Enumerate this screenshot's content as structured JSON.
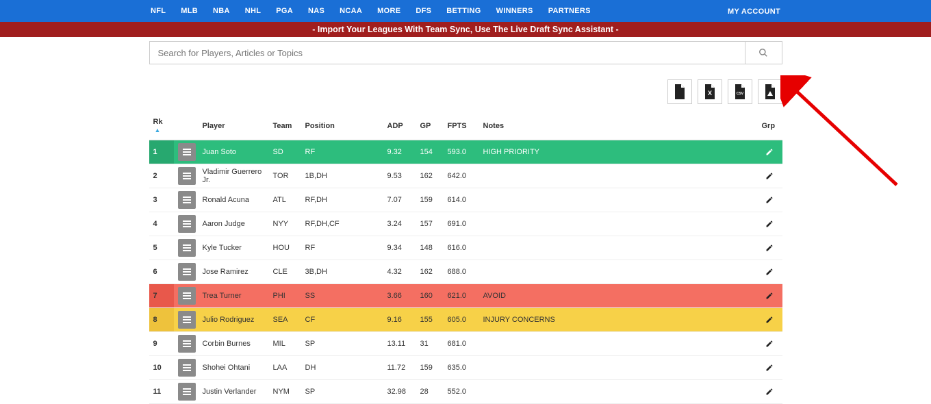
{
  "nav": {
    "items": [
      "NFL",
      "MLB",
      "NBA",
      "NHL",
      "PGA",
      "NAS",
      "NCAA",
      "MORE",
      "DFS",
      "BETTING",
      "WINNERS",
      "PARTNERS"
    ],
    "account": "MY ACCOUNT"
  },
  "banner": "- Import Your Leagues With Team Sync, Use The Live Draft Sync Assistant -",
  "search": {
    "placeholder": "Search for Players, Articles or Topics"
  },
  "table": {
    "headers": {
      "rk": "Rk",
      "player": "Player",
      "team": "Team",
      "position": "Position",
      "adp": "ADP",
      "gp": "GP",
      "fpts": "FPTS",
      "notes": "Notes",
      "grp": "Grp"
    },
    "rows": [
      {
        "rk": "1",
        "player": "Juan Soto",
        "team": "SD",
        "position": "RF",
        "adp": "9.32",
        "gp": "154",
        "fpts": "593.0",
        "notes": "HIGH PRIORITY",
        "hl": "green"
      },
      {
        "rk": "2",
        "player": "Vladimir Guerrero Jr.",
        "team": "TOR",
        "position": "1B,DH",
        "adp": "9.53",
        "gp": "162",
        "fpts": "642.0",
        "notes": "",
        "hl": ""
      },
      {
        "rk": "3",
        "player": "Ronald Acuna",
        "team": "ATL",
        "position": "RF,DH",
        "adp": "7.07",
        "gp": "159",
        "fpts": "614.0",
        "notes": "",
        "hl": ""
      },
      {
        "rk": "4",
        "player": "Aaron Judge",
        "team": "NYY",
        "position": "RF,DH,CF",
        "adp": "3.24",
        "gp": "157",
        "fpts": "691.0",
        "notes": "",
        "hl": ""
      },
      {
        "rk": "5",
        "player": "Kyle Tucker",
        "team": "HOU",
        "position": "RF",
        "adp": "9.34",
        "gp": "148",
        "fpts": "616.0",
        "notes": "",
        "hl": ""
      },
      {
        "rk": "6",
        "player": "Jose Ramirez",
        "team": "CLE",
        "position": "3B,DH",
        "adp": "4.32",
        "gp": "162",
        "fpts": "688.0",
        "notes": "",
        "hl": ""
      },
      {
        "rk": "7",
        "player": "Trea Turner",
        "team": "PHI",
        "position": "SS",
        "adp": "3.66",
        "gp": "160",
        "fpts": "621.0",
        "notes": "AVOID",
        "hl": "red"
      },
      {
        "rk": "8",
        "player": "Julio Rodriguez",
        "team": "SEA",
        "position": "CF",
        "adp": "9.16",
        "gp": "155",
        "fpts": "605.0",
        "notes": "INJURY CONCERNS",
        "hl": "yellow"
      },
      {
        "rk": "9",
        "player": "Corbin Burnes",
        "team": "MIL",
        "position": "SP",
        "adp": "13.11",
        "gp": "31",
        "fpts": "681.0",
        "notes": "",
        "hl": ""
      },
      {
        "rk": "10",
        "player": "Shohei Ohtani",
        "team": "LAA",
        "position": "DH",
        "adp": "11.72",
        "gp": "159",
        "fpts": "635.0",
        "notes": "",
        "hl": ""
      },
      {
        "rk": "11",
        "player": "Justin Verlander",
        "team": "NYM",
        "position": "SP",
        "adp": "32.98",
        "gp": "28",
        "fpts": "552.0",
        "notes": "",
        "hl": ""
      }
    ]
  }
}
